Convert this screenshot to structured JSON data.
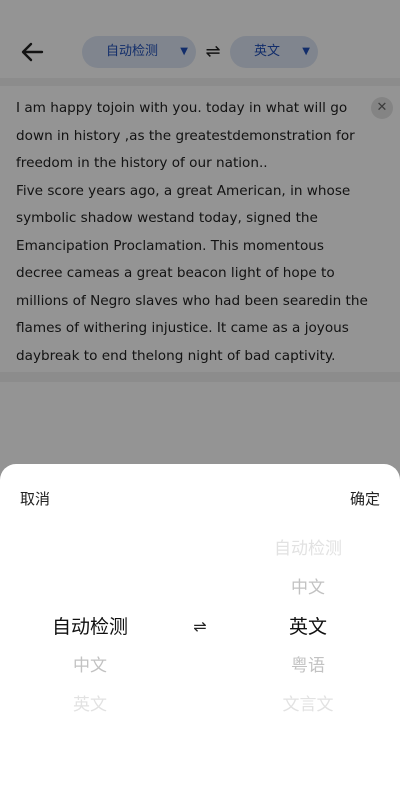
{
  "header": {
    "source_lang": "自动检测",
    "target_lang": "英文",
    "dropdown_glyph": "▼",
    "swap_glyph": "⇌"
  },
  "editor": {
    "paragraphs": [
      " I am happy tojoin with you. today in what will go down in history ,as the greatestdemonstration for freedom in the history of our nation..",
      "Five score years ago, a great American, in whose symbolic shadow westand today, signed the Emancipation Proclamation. This momentous decree cameas a great beacon light of hope to millions of Negro slaves who had been searedin the flames of withering injustice. It came as a joyous daybreak to end thelong night of bad captivity."
    ],
    "clear_glyph": "✕"
  },
  "sheet": {
    "cancel_label": "取消",
    "confirm_label": "确定",
    "swap_glyph": "⇌",
    "source_options": [
      "自动检测",
      "中文",
      "英文"
    ],
    "target_options": [
      "自动检测",
      "中文",
      "英文",
      "粤语",
      "文言文"
    ],
    "source_selected": "自动检测",
    "target_selected": "英文"
  },
  "colors": {
    "pill_bg": "#dde6f5",
    "pill_text": "#1f4fb8",
    "scrim": "rgba(0,0,0,0.42)"
  }
}
